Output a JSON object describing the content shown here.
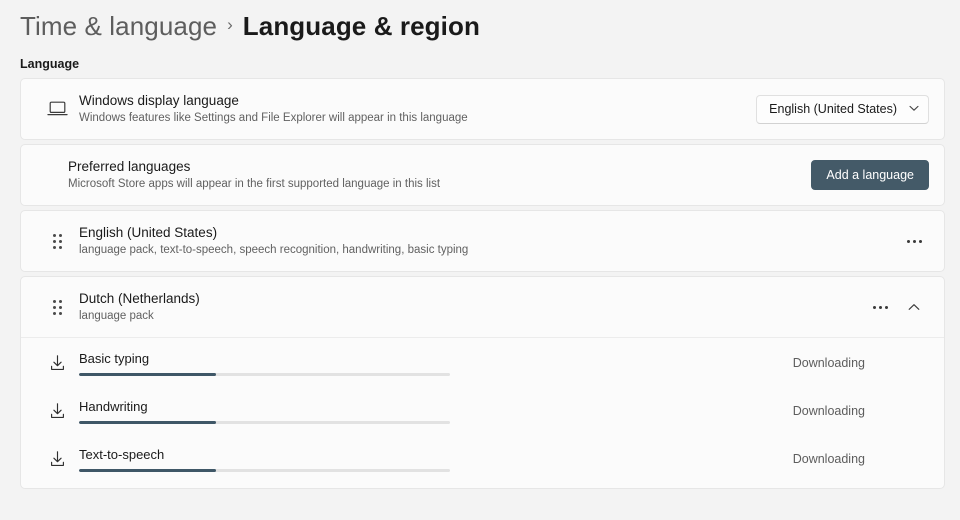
{
  "breadcrumb": {
    "parent": "Time & language",
    "separator": "›",
    "current": "Language & region"
  },
  "section": {
    "label": "Language"
  },
  "display_language": {
    "icon": "laptop-icon",
    "title": "Windows display language",
    "subtitle": "Windows features like Settings and File Explorer will appear in this language",
    "dropdown_value": "English (United States)",
    "dropdown_chevron": "⌄"
  },
  "preferred_languages": {
    "title": "Preferred languages",
    "subtitle": "Microsoft Store apps will appear in the first supported language in this list",
    "add_button_label": "Add a language"
  },
  "languages": [
    {
      "name": "English (United States)",
      "features": "language pack, text-to-speech, speech recognition, handwriting, basic typing",
      "expanded": false,
      "has_chevron": false
    },
    {
      "name": "Dutch (Netherlands)",
      "features": "language pack",
      "expanded": true,
      "has_chevron": true
    }
  ],
  "downloads": [
    {
      "label": "Basic typing",
      "status": "Downloading",
      "progress": 37
    },
    {
      "label": "Handwriting",
      "status": "Downloading",
      "progress": 37
    },
    {
      "label": "Text-to-speech",
      "status": "Downloading",
      "progress": 37
    }
  ],
  "colors": {
    "page_background": "#f3f3f3",
    "card_background": "#fbfbfb",
    "accent_button": "#445a68",
    "progress_fill": "#3f5767",
    "progress_track": "#e2e2e2"
  }
}
